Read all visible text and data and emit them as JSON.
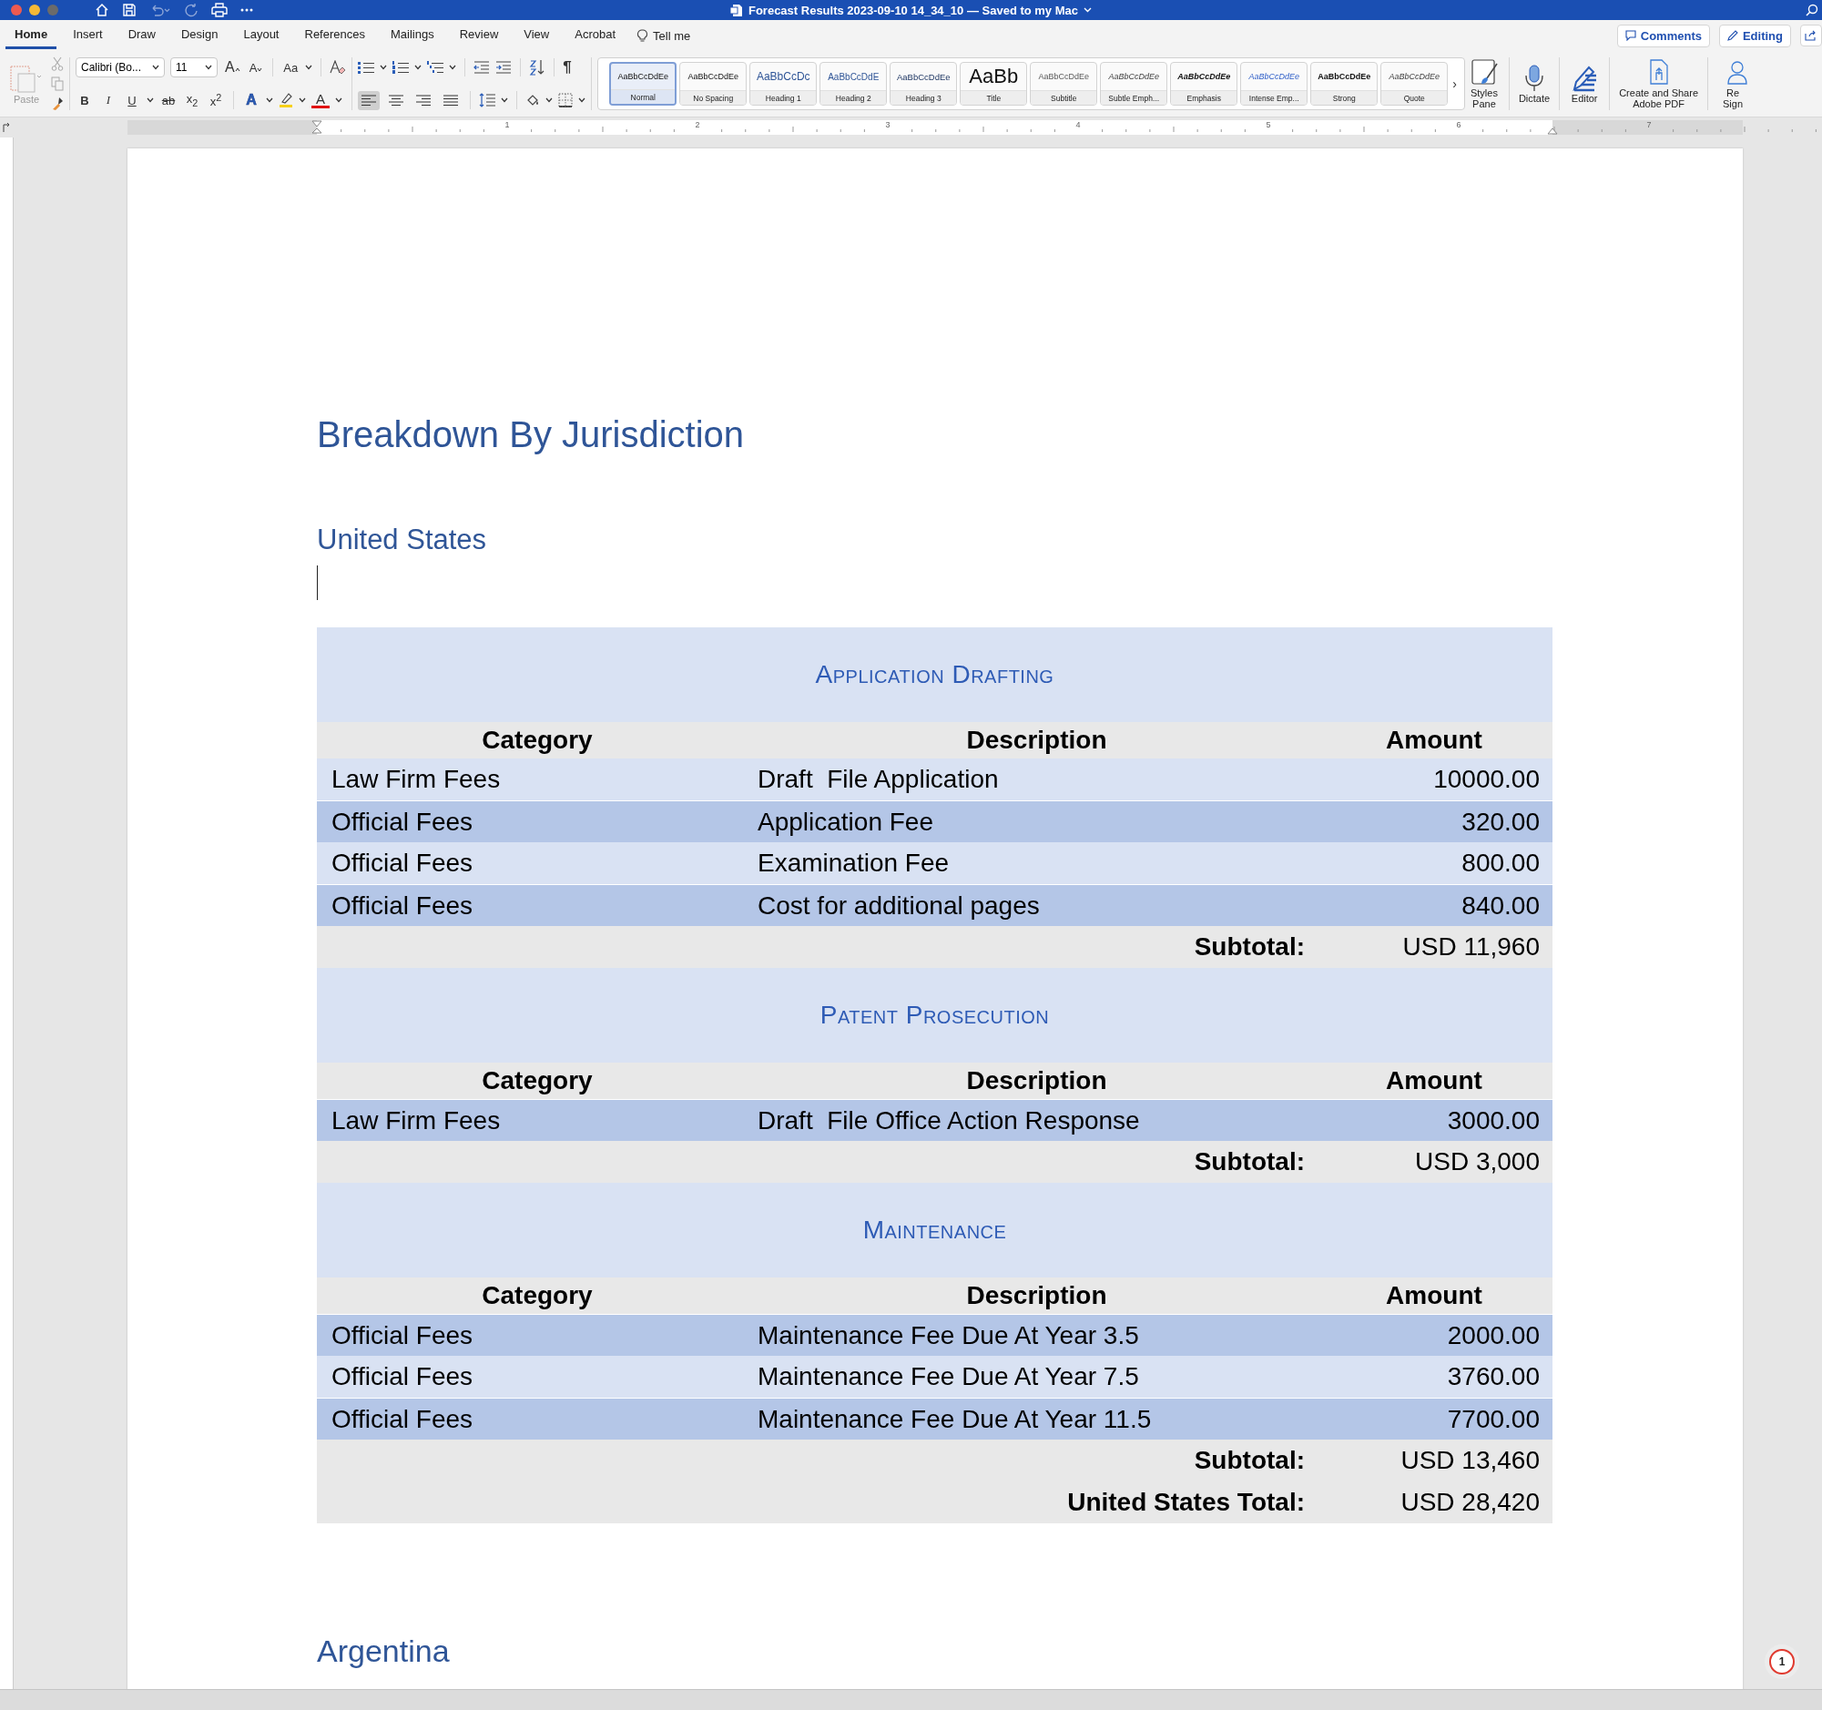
{
  "window": {
    "title": "Forecast Results  2023-09-10 14_34_10 — Saved to my Mac"
  },
  "tabs": [
    {
      "label": "Home",
      "selected": true
    },
    {
      "label": "Insert",
      "selected": false
    },
    {
      "label": "Draw",
      "selected": false
    },
    {
      "label": "Design",
      "selected": false
    },
    {
      "label": "Layout",
      "selected": false
    },
    {
      "label": "References",
      "selected": false
    },
    {
      "label": "Mailings",
      "selected": false
    },
    {
      "label": "Review",
      "selected": false
    },
    {
      "label": "View",
      "selected": false
    },
    {
      "label": "Acrobat",
      "selected": false
    }
  ],
  "tell_me": {
    "label": "Tell me"
  },
  "header_buttons": [
    {
      "label": "Comments",
      "kind": "comments"
    },
    {
      "label": "Editing",
      "kind": "editing"
    }
  ],
  "clipboard": {
    "paste_label": "Paste"
  },
  "font": {
    "name": "Calibri (Bo...",
    "size": "11",
    "grow": "A",
    "shrink": "A",
    "change_case": "Aa"
  },
  "format_buttons": [
    {
      "kind": "bold",
      "label": "B"
    },
    {
      "kind": "italic",
      "label": "I"
    },
    {
      "kind": "underline",
      "label": "U"
    },
    {
      "kind": "strike",
      "label": "ab"
    },
    {
      "kind": "sub",
      "label": "x$_{2}$"
    },
    {
      "kind": "sup",
      "label": "x$^{2}$"
    },
    {
      "kind": "effects",
      "label": "A"
    },
    {
      "kind": "color",
      "label": "A"
    }
  ],
  "paragraph": {
    "pilcrow": "¶",
    "alignment_buttons": [
      {
        "kind": "left",
        "selected": true
      },
      {
        "kind": "center",
        "selected": false
      },
      {
        "kind": "right",
        "selected": false
      },
      {
        "kind": "justify",
        "selected": false
      }
    ]
  },
  "styles": [
    {
      "sample": "AaBbCcDdEe",
      "label": "Normal",
      "kind": "normal",
      "selected": true
    },
    {
      "sample": "AaBbCcDdEe",
      "label": "No Spacing",
      "kind": "normal",
      "selected": false
    },
    {
      "sample": "AaBbCcDc",
      "label": "Heading 1",
      "kind": "heading1",
      "selected": false
    },
    {
      "sample": "AaBbCcDdE",
      "label": "Heading 2",
      "kind": "heading2",
      "selected": false
    },
    {
      "sample": "AaBbCcDdEe",
      "label": "Heading 3",
      "kind": "heading3",
      "selected": false
    },
    {
      "sample": "AaBb",
      "label": "Title",
      "kind": "title",
      "selected": false
    },
    {
      "sample": "AaBbCcDdEe",
      "label": "Subtitle",
      "kind": "subtitle",
      "selected": false
    },
    {
      "sample": "AaBbCcDdEe",
      "label": "Subtle Emph...",
      "kind": "subtle",
      "selected": false
    },
    {
      "sample": "AaBbCcDdEe",
      "label": "Emphasis",
      "kind": "emphasis",
      "selected": false
    },
    {
      "sample": "AaBbCcDdEe",
      "label": "Intense Emp...",
      "kind": "intense",
      "selected": false
    },
    {
      "sample": "AaBbCcDdEe",
      "label": "Strong",
      "kind": "strong",
      "selected": false
    },
    {
      "sample": "AaBbCcDdEe",
      "label": "Quote",
      "kind": "quote",
      "selected": false
    }
  ],
  "more_styles": "›",
  "ribbon_buttons": [
    {
      "lines": [
        "Styles",
        "Pane"
      ],
      "kind": "styles-pane"
    },
    {
      "lines": [
        "Dictate"
      ],
      "kind": "dictate"
    },
    {
      "lines": [
        "Editor"
      ],
      "kind": "editor"
    },
    {
      "lines": [
        "Create and Share",
        "Adobe PDF"
      ],
      "kind": "pdf"
    },
    {
      "lines": [
        "Re",
        "Sign"
      ],
      "kind": "signature"
    }
  ],
  "ruler": {
    "numbers": [
      "1",
      "2",
      "3",
      "4",
      "5",
      "6",
      "7"
    ]
  },
  "document": {
    "heading": "Breakdown By Jurisdiction",
    "subheading": "United States",
    "sections": [
      {
        "title": "Application Drafting",
        "columns": [
          "Category",
          "Description",
          "Amount"
        ],
        "rows": [
          {
            "category": "Law Firm Fees",
            "description": "Draft  File Application",
            "amount": "10000.00",
            "shaded": false
          },
          {
            "category": "Official Fees",
            "description": "Application Fee",
            "amount": "320.00",
            "shaded": true
          },
          {
            "category": "Official Fees",
            "description": "Examination Fee",
            "amount": "800.00",
            "shaded": false
          },
          {
            "category": "Official Fees",
            "description": "Cost for additional pages",
            "amount": "840.00",
            "shaded": true
          }
        ],
        "subtotal_label": "Subtotal:",
        "subtotal": "USD 11,960"
      },
      {
        "title": "Patent Prosecution",
        "columns": [
          "Category",
          "Description",
          "Amount"
        ],
        "rows": [
          {
            "category": "Law Firm Fees",
            "description": "Draft  File Office Action Response",
            "amount": "3000.00",
            "shaded": true
          }
        ],
        "subtotal_label": "Subtotal:",
        "subtotal": "USD 3,000"
      },
      {
        "title": "Maintenance",
        "columns": [
          "Category",
          "Description",
          "Amount"
        ],
        "rows": [
          {
            "category": "Official Fees",
            "description": "Maintenance Fee Due At Year 3.5",
            "amount": "2000.00",
            "shaded": true
          },
          {
            "category": "Official Fees",
            "description": "Maintenance Fee Due At Year 7.5",
            "amount": "3760.00",
            "shaded": false
          },
          {
            "category": "Official Fees",
            "description": "Maintenance Fee Due At Year 11.5",
            "amount": "7700.00",
            "shaded": true
          }
        ],
        "subtotal_label": "Subtotal:",
        "subtotal": "USD 13,460"
      }
    ],
    "total_label": "United States Total:",
    "total": "USD 28,420",
    "next_heading": "Argentina"
  },
  "comment_badge": "1"
}
